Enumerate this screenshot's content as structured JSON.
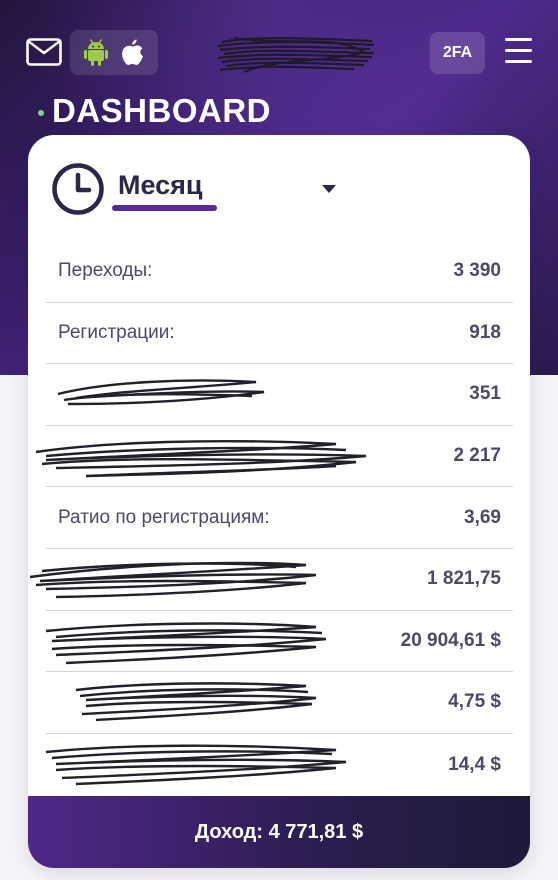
{
  "header": {
    "mail_icon": "mail-icon",
    "platforms": [
      "android-icon",
      "apple-icon"
    ],
    "twofa_label": "2FA",
    "menu_icon": "hamburger-menu-icon"
  },
  "page": {
    "title": "DASHBOARD"
  },
  "card": {
    "period_label": "Месяц",
    "stats": [
      {
        "label": "Переходы:",
        "value": "3 390",
        "redacted": false
      },
      {
        "label": "Регистрации:",
        "value": "918",
        "redacted": false
      },
      {
        "label": "",
        "value": "351",
        "redacted": true
      },
      {
        "label": "",
        "value": "2 217",
        "redacted": true
      },
      {
        "label": "Ратио по регистрациям:",
        "value": "3,69",
        "redacted": false
      },
      {
        "label": "",
        "value": "1 821,75",
        "redacted": true
      },
      {
        "label": "",
        "value": "20 904,61 $",
        "redacted": true
      },
      {
        "label": "",
        "value": "4,75 $",
        "redacted": true
      },
      {
        "label": "",
        "value": "14,4 $",
        "redacted": true
      }
    ],
    "income_label": "Доход: 4 771,81 $"
  },
  "colors": {
    "brand_purple": "#4e2a8a",
    "accent_underline": "#5a2a9a",
    "text_dark": "#2b2847",
    "text_muted": "#4c4a66",
    "status_dot": "#7fd18a"
  }
}
